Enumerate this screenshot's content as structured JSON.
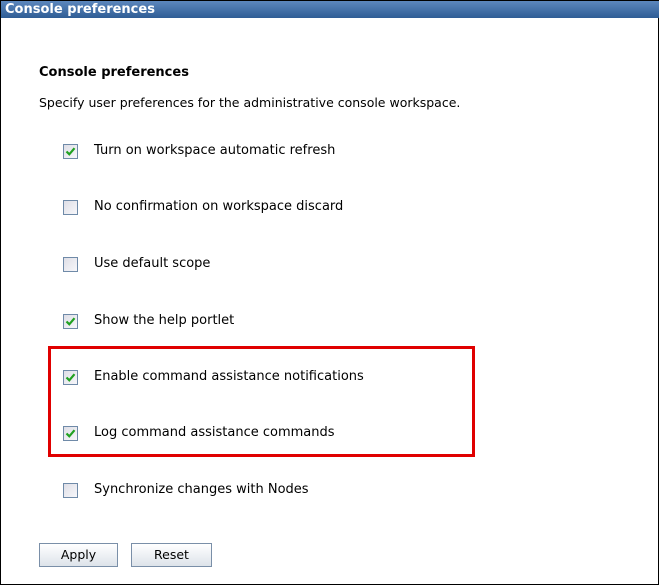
{
  "panel": {
    "title": "Console preferences"
  },
  "section": {
    "heading": "Console preferences",
    "description": "Specify user preferences for the administrative console workspace."
  },
  "preferences": [
    {
      "label": "Turn on workspace automatic refresh",
      "checked": true
    },
    {
      "label": "No confirmation on workspace discard",
      "checked": false
    },
    {
      "label": "Use default scope",
      "checked": false
    },
    {
      "label": "Show the help portlet",
      "checked": true
    },
    {
      "label": "Enable command assistance notifications",
      "checked": true
    },
    {
      "label": "Log command assistance commands",
      "checked": true
    },
    {
      "label": "Synchronize changes with Nodes",
      "checked": false
    }
  ],
  "buttons": {
    "apply": "Apply",
    "reset": "Reset"
  },
  "colors": {
    "titlebar": "#3e6ca3",
    "highlight": "#e00000",
    "checkmark": "#21a121"
  }
}
